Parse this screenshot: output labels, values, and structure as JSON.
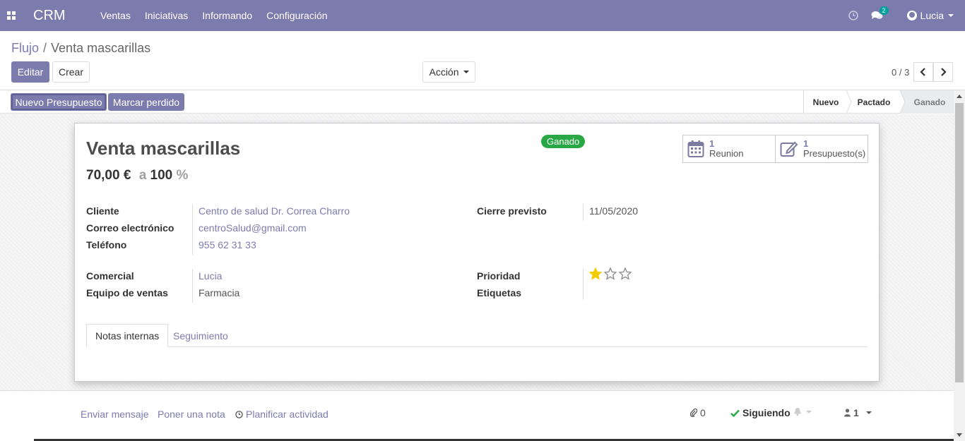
{
  "navbar": {
    "brand": "CRM",
    "menu": [
      "Ventas",
      "Iniciativas",
      "Informando",
      "Configuración"
    ],
    "chat_badge": "2",
    "user_name": "Lucia"
  },
  "breadcrumb": {
    "parent": "Flujo",
    "separator": "/",
    "current": "Venta mascarillas"
  },
  "toolbar": {
    "edit_label": "Editar",
    "create_label": "Crear",
    "action_label": "Acción",
    "pager": "0 / 3"
  },
  "statusbar": {
    "buttons": [
      "Nuevo Presupuesto",
      "Marcar perdido"
    ],
    "stages": [
      "Nuevo",
      "Pactado",
      "Ganado"
    ],
    "active_stage": "Ganado"
  },
  "record": {
    "ribbon": "Ganado",
    "title": "Venta mascarillas",
    "revenue": "70,00 €",
    "at_label": "a",
    "probability": "100",
    "percent": "%",
    "smart_buttons": [
      {
        "count": "1",
        "label": "Reunion",
        "icon": "calendar-icon"
      },
      {
        "count": "1",
        "label": "Presupuesto(s)",
        "icon": "edit-icon"
      }
    ],
    "fields": {
      "customer_label": "Cliente",
      "customer": "Centro de salud Dr. Correa Charro",
      "email_label": "Correo electrónico",
      "email": "centroSalud@gmail.com",
      "phone_label": "Teléfono",
      "phone": "955 62 31 33",
      "closing_label": "Cierre previsto",
      "closing": "11/05/2020",
      "salesperson_label": "Comercial",
      "salesperson": "Lucia",
      "team_label": "Equipo de ventas",
      "team": "Farmacia",
      "priority_label": "Prioridad",
      "priority": 1,
      "priority_max": 3,
      "tags_label": "Etiquetas"
    },
    "tabs": [
      "Notas internas",
      "Seguimiento"
    ]
  },
  "chatter": {
    "send_message": "Enviar mensaje",
    "log_note": "Poner una nota",
    "schedule_activity": "Planificar actividad",
    "attachments": "0",
    "following": "Siguiendo",
    "followers": "1"
  },
  "colors": {
    "brand": "#7c7bad",
    "success": "#28a745",
    "star": "#f3cc00"
  }
}
